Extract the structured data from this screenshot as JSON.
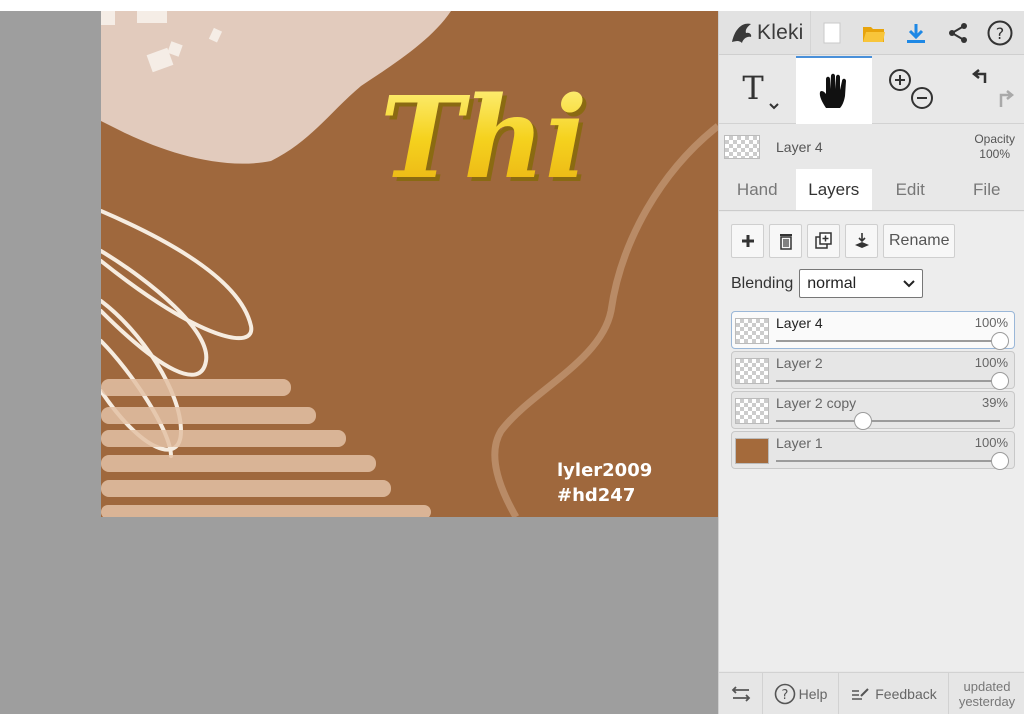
{
  "app": {
    "name": "Kleki"
  },
  "toolbar": {
    "icons": [
      "new-image-icon",
      "open-folder-icon",
      "download-icon",
      "share-icon",
      "help-circle-icon"
    ],
    "tools": [
      "text-tool-icon",
      "hand-tool-icon",
      "zoom-icon",
      "undo-redo-icon"
    ]
  },
  "current_layer": {
    "name": "Layer 4",
    "opacity_label": "Opacity",
    "opacity_value": "100%"
  },
  "tabs": [
    {
      "label": "Hand"
    },
    {
      "label": "Layers"
    },
    {
      "label": "Edit"
    },
    {
      "label": "File"
    }
  ],
  "layer_actions": {
    "rename_label": "Rename"
  },
  "blending": {
    "label": "Blending",
    "value": "normal"
  },
  "layers": [
    {
      "name": "Layer 4",
      "opacity": "100%",
      "opacity_value": 1.0,
      "selected": true,
      "thumb": "transparent"
    },
    {
      "name": "Layer 2",
      "opacity": "100%",
      "opacity_value": 1.0,
      "selected": false,
      "thumb": "transparent"
    },
    {
      "name": "Layer 2 copy",
      "opacity": "39%",
      "opacity_value": 0.39,
      "selected": false,
      "thumb": "transparent"
    },
    {
      "name": "Layer 1",
      "opacity": "100%",
      "opacity_value": 1.0,
      "selected": false,
      "thumb": "brown"
    }
  ],
  "canvas_text": {
    "title": "Thi",
    "line1": "lyler2009",
    "line2": "#hd247"
  },
  "footer": {
    "help": "Help",
    "feedback": "Feedback",
    "updated_line1": "updated",
    "updated_line2": "yesterday"
  },
  "colors": {
    "accent": "#4a90d9",
    "canvas_brown": "#a06b3f",
    "title_yellow": "#f0c419",
    "workspace_gray": "#9e9e9e"
  }
}
